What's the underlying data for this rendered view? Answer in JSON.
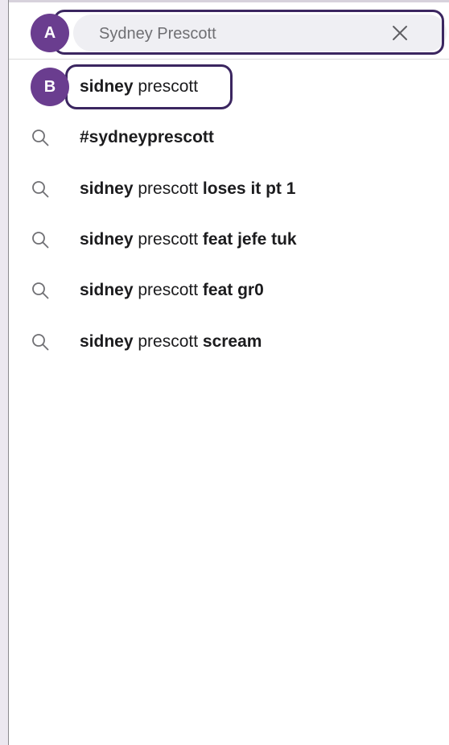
{
  "search": {
    "value": "Sydney Prescott",
    "clear_icon": "close-icon"
  },
  "callouts": {
    "a": "A",
    "b": "B"
  },
  "suggestions": [
    {
      "bold_prefix": "sidney",
      "normal": " prescott",
      "bold_suffix": "",
      "icon": ""
    },
    {
      "bold_prefix": "#sydneyprescott",
      "normal": "",
      "bold_suffix": "",
      "icon": "search-icon"
    },
    {
      "bold_prefix": "sidney",
      "normal": " prescott ",
      "bold_suffix": "loses it pt 1",
      "icon": "search-icon"
    },
    {
      "bold_prefix": "sidney",
      "normal": " prescott ",
      "bold_suffix": "feat jefe tuk",
      "icon": "search-icon"
    },
    {
      "bold_prefix": "sidney",
      "normal": " prescott ",
      "bold_suffix": "feat gr0",
      "icon": "search-icon"
    },
    {
      "bold_prefix": "sidney",
      "normal": " prescott ",
      "bold_suffix": "scream",
      "icon": "search-icon"
    }
  ],
  "colors": {
    "callout": "#6a3d8f",
    "callout_border": "#3b2660"
  }
}
